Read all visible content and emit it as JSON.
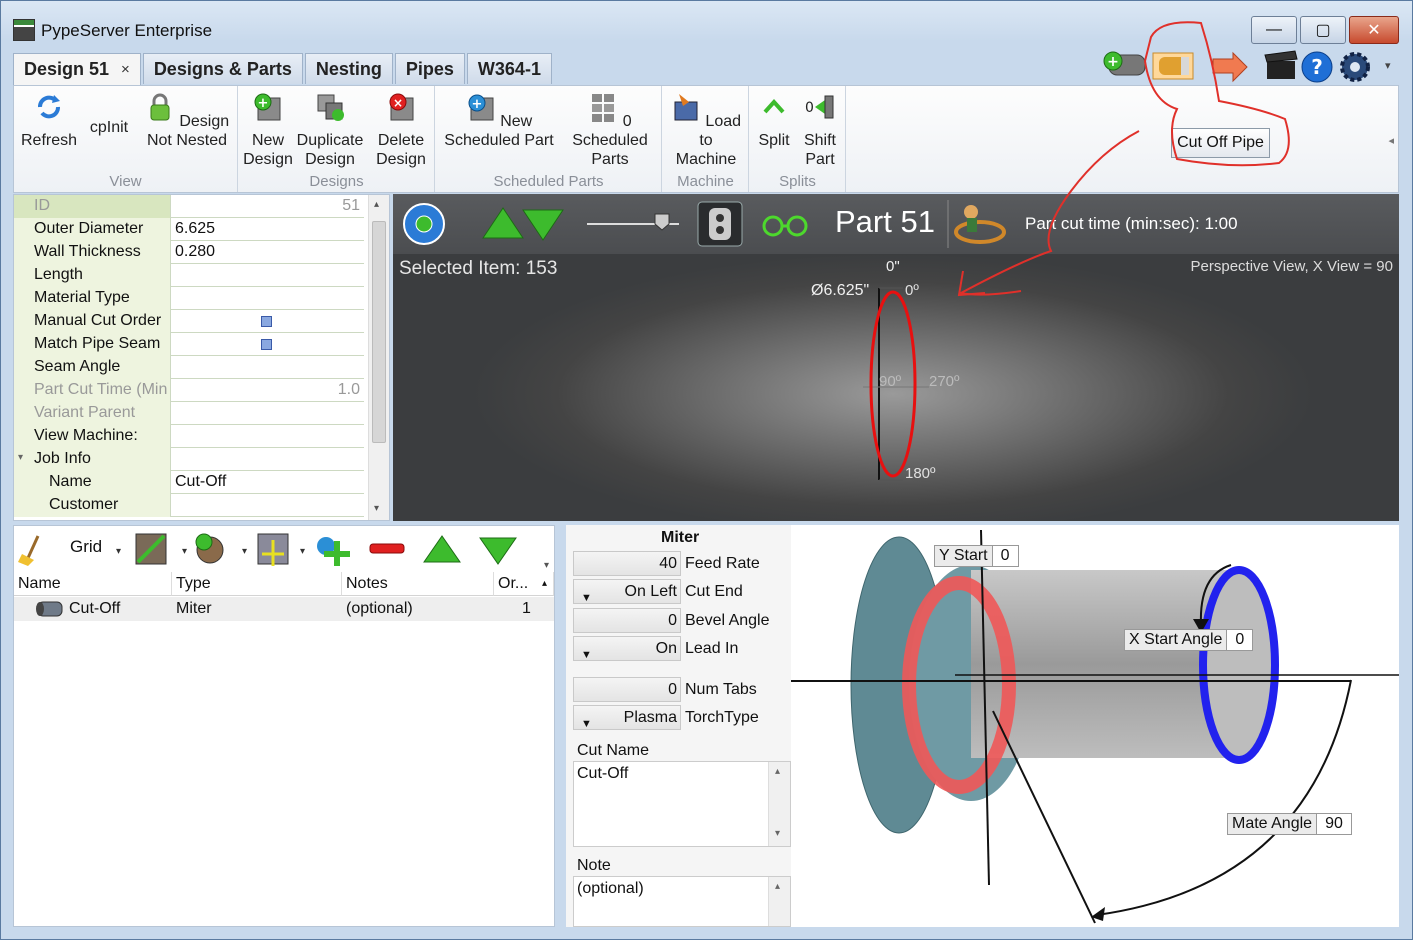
{
  "window": {
    "title": "PypeServer Enterprise",
    "minimize": "—",
    "maximize": "▢",
    "close": "✕"
  },
  "tabs": [
    {
      "label": "Design 51",
      "close": "×",
      "active": true
    },
    {
      "label": "Designs & Parts"
    },
    {
      "label": "Nesting"
    },
    {
      "label": "Pipes"
    },
    {
      "label": "W364-1"
    }
  ],
  "ribbon": {
    "groups": {
      "view": "View",
      "designs": "Designs",
      "scheduled": "Scheduled Parts",
      "machine": "Machine",
      "splits": "Splits"
    },
    "buttons": {
      "refresh": "Refresh",
      "cpinit": "cpInit",
      "design_not_nested": "Design Not Nested",
      "new_design": "New Design",
      "duplicate_design": "Duplicate Design",
      "delete_design": "Delete Design",
      "new_scheduled_part": "New Scheduled Part",
      "zero_scheduled_parts": "0 Scheduled Parts",
      "load_to_machine": "Load to Machine",
      "split": "Split",
      "shift_part": "Shift Part"
    },
    "tooltip": "Cut Off Pipe"
  },
  "properties": [
    {
      "name": "ID",
      "value": "51",
      "readonly": true
    },
    {
      "name": "Outer Diameter",
      "value": "6.625"
    },
    {
      "name": "Wall Thickness",
      "value": "0.280"
    },
    {
      "name": "Length",
      "value": ""
    },
    {
      "name": "Material Type",
      "value": ""
    },
    {
      "name": "Manual Cut Order",
      "value": ""
    },
    {
      "name": "Match Pipe Seam",
      "value": ""
    },
    {
      "name": "Seam Angle",
      "value": ""
    },
    {
      "name": "Part Cut Time (Min",
      "value": "1.0",
      "readonly": true
    },
    {
      "name": "Variant Parent",
      "value": "",
      "readonly": true
    },
    {
      "name": "View Machine:",
      "value": ""
    },
    {
      "name": "Job Info",
      "value": ""
    },
    {
      "name": "Name",
      "value": "Cut-Off"
    },
    {
      "name": "Customer",
      "value": ""
    }
  ],
  "viewer": {
    "part_label": "Part 51",
    "cut_time": "Part cut time (min:sec): 1:00",
    "selected": "Selected Item: 153",
    "view_info": "Perspective View,  X View = 90",
    "annotations": {
      "top_deg": "0\"",
      "diameter": "Ø6.625\"",
      "zero": "0º",
      "ninety": "90º",
      "two_seventy": "270º",
      "one_eighty": "180º"
    }
  },
  "cutlist": {
    "grid_label": "Grid",
    "columns": [
      "Name",
      "Type",
      "Notes",
      "Or..."
    ],
    "rows": [
      {
        "name": "Cut-Off",
        "type": "Miter",
        "notes": "(optional)",
        "order": "1"
      }
    ]
  },
  "cut_details": {
    "title": "Miter",
    "feed_rate": {
      "value": "40",
      "label": "Feed Rate"
    },
    "cut_end": {
      "value": "On Left",
      "label": "Cut End"
    },
    "bevel_angle": {
      "value": "0",
      "label": "Bevel Angle"
    },
    "lead_in": {
      "value": "On",
      "label": "Lead In"
    },
    "num_tabs": {
      "value": "0",
      "label": "Num Tabs"
    },
    "torch_type": {
      "value": "Plasma",
      "label": "TorchType"
    },
    "cut_name_label": "Cut Name",
    "cut_name_value": "Cut-Off",
    "note_label": "Note",
    "note_value": "(optional)"
  },
  "diagram": {
    "y_start": {
      "label": "Y Start",
      "value": "0"
    },
    "x_start_angle": {
      "label": "X Start Angle",
      "value": "0"
    },
    "mate_angle": {
      "label": "Mate Angle",
      "value": "90"
    }
  },
  "colors": {
    "accent": "#e0302a",
    "pipe_blue": "#2222ee",
    "cut_red": "#ee5555",
    "viewer_bg": "#3b3d3f"
  }
}
